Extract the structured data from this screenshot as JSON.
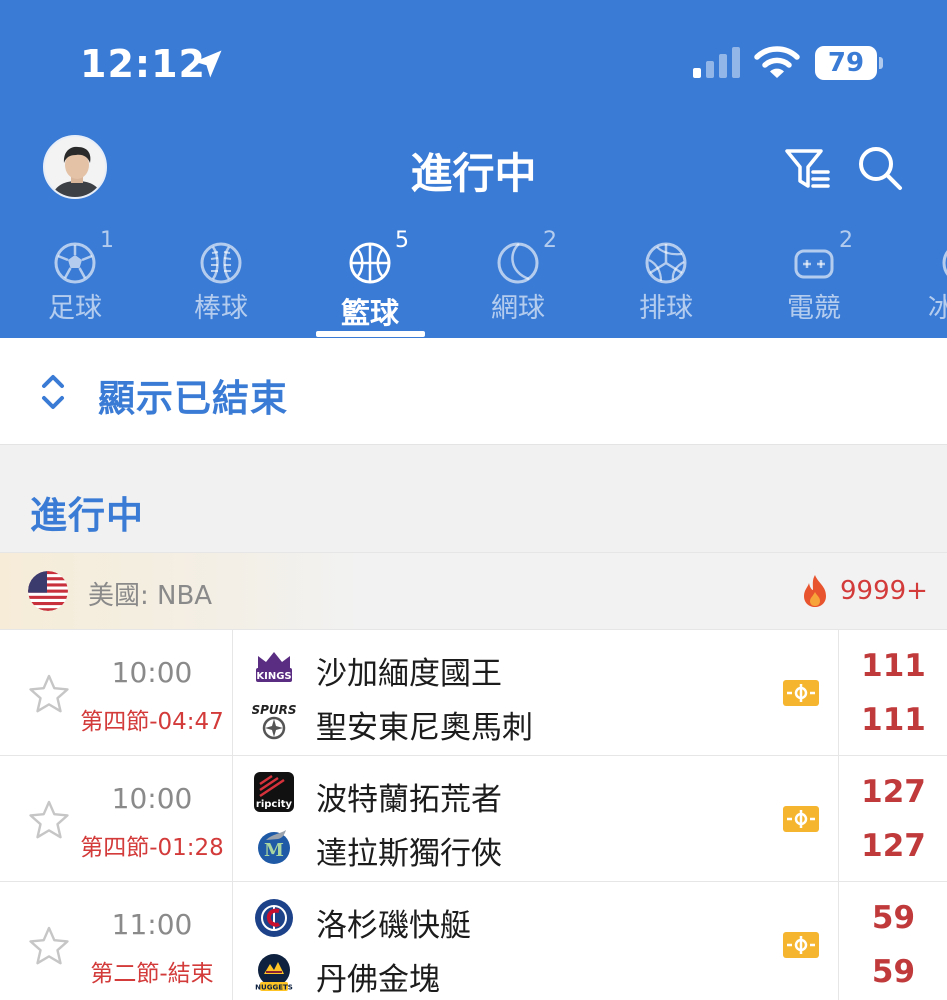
{
  "status_bar": {
    "time": "12:12",
    "battery": "79",
    "battery_level": 0.79
  },
  "header": {
    "title": "進行中"
  },
  "tabs": [
    {
      "label": "足球",
      "count": "1",
      "icon": "soccer-ball-icon"
    },
    {
      "label": "棒球",
      "count": "",
      "icon": "baseball-icon"
    },
    {
      "label": "籃球",
      "count": "5",
      "icon": "basketball-icon",
      "active": true
    },
    {
      "label": "網球",
      "count": "2",
      "icon": "tennis-ball-icon"
    },
    {
      "label": "排球",
      "count": "",
      "icon": "volleyball-icon"
    },
    {
      "label": "電競",
      "count": "2",
      "icon": "gamepad-icon"
    },
    {
      "label": "冰",
      "count": "",
      "icon": "hockey-icon"
    }
  ],
  "show_finished": {
    "label": "顯示已結束"
  },
  "section": {
    "title": "進行中"
  },
  "league": {
    "name": "美國: NBA",
    "hot_count": "9999+"
  },
  "matches": [
    {
      "time": "10:00",
      "status": "第四節-04:47",
      "home": {
        "name": "沙加緬度國王",
        "score": "111",
        "logo": "kings-logo"
      },
      "away": {
        "name": "聖安東尼奧馬刺",
        "score": "111",
        "logo": "spurs-logo"
      }
    },
    {
      "time": "10:00",
      "status": "第四節-01:28",
      "home": {
        "name": "波特蘭拓荒者",
        "score": "127",
        "logo": "blazers-logo"
      },
      "away": {
        "name": "達拉斯獨行俠",
        "score": "127",
        "logo": "mavericks-logo"
      }
    },
    {
      "time": "11:00",
      "status": "第二節-結束",
      "home": {
        "name": "洛杉磯快艇",
        "score": "59",
        "logo": "clippers-logo"
      },
      "away": {
        "name": "丹佛金塊",
        "score": "59",
        "logo": "nuggets-logo"
      }
    }
  ],
  "colors": {
    "brand_blue": "#3a7bd5",
    "score_red": "#c0393b",
    "field_orange": "#f5b52e"
  }
}
